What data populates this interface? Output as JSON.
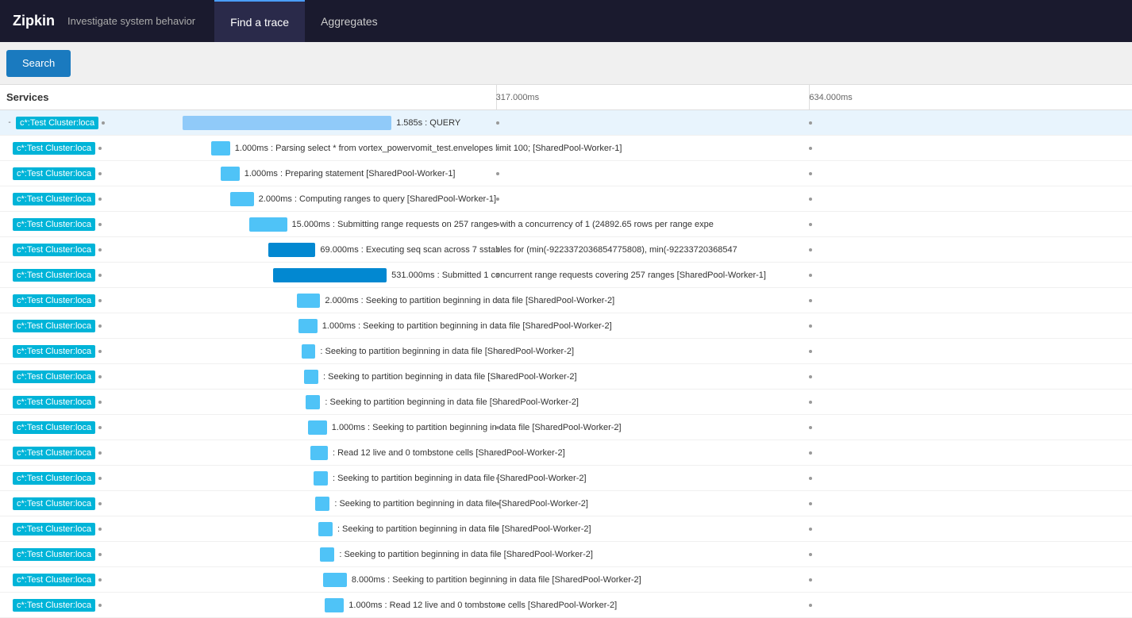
{
  "nav": {
    "brand": "Zipkin",
    "subtitle": "Investigate system behavior",
    "tabs": [
      {
        "id": "find-trace",
        "label": "Find a trace",
        "active": true
      },
      {
        "id": "aggregates",
        "label": "Aggregates",
        "active": false
      }
    ]
  },
  "search_button_label": "Search",
  "timeline": {
    "services_col_label": "Services",
    "marks": [
      {
        "value": "317.000ms",
        "percent": 33
      },
      {
        "value": "634.000ms",
        "percent": 66
      }
    ]
  },
  "rows": [
    {
      "id": "row-0",
      "indent": 0,
      "is_root": true,
      "collapse": "-",
      "service": "c*:Test Cluster:loca",
      "has_dot": true,
      "bar_left_pct": 0,
      "bar_width_pct": 22,
      "bar_type": "root-bar",
      "label": "1.585s : QUERY",
      "label_offset_pct": 22
    },
    {
      "id": "row-1",
      "indent": 1,
      "is_root": false,
      "service": "c*:Test Cluster:loca",
      "has_dot": true,
      "bar_left_pct": 3,
      "bar_width_pct": 2,
      "bar_type": "child-bar",
      "label": "1.000ms : Parsing select * from vortex_powervomit_test.envelopes limit 100; [SharedPool-Worker-1]",
      "label_offset_pct": null
    },
    {
      "id": "row-2",
      "indent": 1,
      "is_root": false,
      "service": "c*:Test Cluster:loca",
      "has_dot": true,
      "bar_left_pct": 4,
      "bar_width_pct": 2,
      "bar_type": "child-bar",
      "label": "1.000ms : Preparing statement [SharedPool-Worker-1]",
      "label_offset_pct": null
    },
    {
      "id": "row-3",
      "indent": 1,
      "is_root": false,
      "service": "c*:Test Cluster:loca",
      "has_dot": true,
      "bar_left_pct": 5,
      "bar_width_pct": 2.5,
      "bar_type": "child-bar",
      "label": "2.000ms : Computing ranges to query [SharedPool-Worker-1]",
      "label_offset_pct": null
    },
    {
      "id": "row-4",
      "indent": 1,
      "is_root": false,
      "service": "c*:Test Cluster:loca",
      "has_dot": true,
      "bar_left_pct": 7,
      "bar_width_pct": 4,
      "bar_type": "child-bar",
      "label": "15.000ms : Submitting range requests on 257 ranges with a concurrency of 1 (24892.65 rows per range expe",
      "label_offset_pct": null
    },
    {
      "id": "row-5",
      "indent": 1,
      "is_root": false,
      "service": "c*:Test Cluster:loca",
      "has_dot": true,
      "bar_left_pct": 9,
      "bar_width_pct": 5,
      "bar_type": "highlighted",
      "label": "69.000ms : Executing seq scan across 7 sstables for (min(-9223372036854775808), min(-92233720368547",
      "label_offset_pct": null
    },
    {
      "id": "row-6",
      "indent": 1,
      "is_root": false,
      "service": "c*:Test Cluster:loca",
      "has_dot": true,
      "bar_left_pct": 9.5,
      "bar_width_pct": 12,
      "bar_type": "highlighted",
      "label": "531.000ms : Submitted 1 concurrent range requests covering 257 ranges [SharedPool-Worker-1]",
      "label_offset_pct": null
    },
    {
      "id": "row-7",
      "indent": 1,
      "is_root": false,
      "service": "c*:Test Cluster:loca",
      "has_dot": true,
      "bar_left_pct": 12,
      "bar_width_pct": 2.5,
      "bar_type": "child-bar",
      "label": "2.000ms : Seeking to partition beginning in data file [SharedPool-Worker-2]",
      "label_offset_pct": null
    },
    {
      "id": "row-8",
      "indent": 1,
      "is_root": false,
      "service": "c*:Test Cluster:loca",
      "has_dot": true,
      "bar_left_pct": 12.2,
      "bar_width_pct": 2,
      "bar_type": "child-bar",
      "label": "1.000ms : Seeking to partition beginning in data file [SharedPool-Worker-2]",
      "label_offset_pct": null
    },
    {
      "id": "row-9",
      "indent": 1,
      "is_root": false,
      "service": "c*:Test Cluster:loca",
      "has_dot": true,
      "bar_left_pct": 12.5,
      "bar_width_pct": 1.5,
      "bar_type": "child-bar",
      "label": ": Seeking to partition beginning in data file [SharedPool-Worker-2]",
      "label_offset_pct": null
    },
    {
      "id": "row-10",
      "indent": 1,
      "is_root": false,
      "service": "c*:Test Cluster:loca",
      "has_dot": true,
      "bar_left_pct": 12.8,
      "bar_width_pct": 1.5,
      "bar_type": "child-bar",
      "label": ": Seeking to partition beginning in data file [SharedPool-Worker-2]",
      "label_offset_pct": null
    },
    {
      "id": "row-11",
      "indent": 1,
      "is_root": false,
      "service": "c*:Test Cluster:loca",
      "has_dot": true,
      "bar_left_pct": 13,
      "bar_width_pct": 1.5,
      "bar_type": "child-bar",
      "label": ": Seeking to partition beginning in data file [SharedPool-Worker-2]",
      "label_offset_pct": null
    },
    {
      "id": "row-12",
      "indent": 1,
      "is_root": false,
      "service": "c*:Test Cluster:loca",
      "has_dot": true,
      "bar_left_pct": 13.2,
      "bar_width_pct": 2,
      "bar_type": "child-bar",
      "label": "1.000ms : Seeking to partition beginning in data file [SharedPool-Worker-2]",
      "label_offset_pct": null
    },
    {
      "id": "row-13",
      "indent": 1,
      "is_root": false,
      "service": "c*:Test Cluster:loca",
      "has_dot": true,
      "bar_left_pct": 13.5,
      "bar_width_pct": 1.8,
      "bar_type": "child-bar",
      "label": ": Read 12 live and 0 tombstone cells [SharedPool-Worker-2]",
      "label_offset_pct": null
    },
    {
      "id": "row-14",
      "indent": 1,
      "is_root": false,
      "service": "c*:Test Cluster:loca",
      "has_dot": true,
      "bar_left_pct": 13.8,
      "bar_width_pct": 1.5,
      "bar_type": "child-bar",
      "label": ": Seeking to partition beginning in data file [SharedPool-Worker-2]",
      "label_offset_pct": null
    },
    {
      "id": "row-15",
      "indent": 1,
      "is_root": false,
      "service": "c*:Test Cluster:loca",
      "has_dot": true,
      "bar_left_pct": 14,
      "bar_width_pct": 1.5,
      "bar_type": "child-bar",
      "label": ": Seeking to partition beginning in data file [SharedPool-Worker-2]",
      "label_offset_pct": null
    },
    {
      "id": "row-16",
      "indent": 1,
      "is_root": false,
      "service": "c*:Test Cluster:loca",
      "has_dot": true,
      "bar_left_pct": 14.3,
      "bar_width_pct": 1.5,
      "bar_type": "child-bar",
      "label": ": Seeking to partition beginning in data file [SharedPool-Worker-2]",
      "label_offset_pct": null
    },
    {
      "id": "row-17",
      "indent": 1,
      "is_root": false,
      "service": "c*:Test Cluster:loca",
      "has_dot": true,
      "bar_left_pct": 14.5,
      "bar_width_pct": 1.5,
      "bar_type": "child-bar",
      "label": ": Seeking to partition beginning in data file [SharedPool-Worker-2]",
      "label_offset_pct": null
    },
    {
      "id": "row-18",
      "indent": 1,
      "is_root": false,
      "service": "c*:Test Cluster:loca",
      "has_dot": true,
      "bar_left_pct": 14.8,
      "bar_width_pct": 2.5,
      "bar_type": "child-bar",
      "label": "8.000ms : Seeking to partition beginning in data file [SharedPool-Worker-2]",
      "label_offset_pct": null
    },
    {
      "id": "row-19",
      "indent": 1,
      "is_root": false,
      "service": "c*:Test Cluster:loca",
      "has_dot": true,
      "bar_left_pct": 15,
      "bar_width_pct": 2,
      "bar_type": "child-bar",
      "label": "1.000ms : Read 12 live and 0 tombstone cells [SharedPool-Worker-2]",
      "label_offset_pct": null
    }
  ]
}
